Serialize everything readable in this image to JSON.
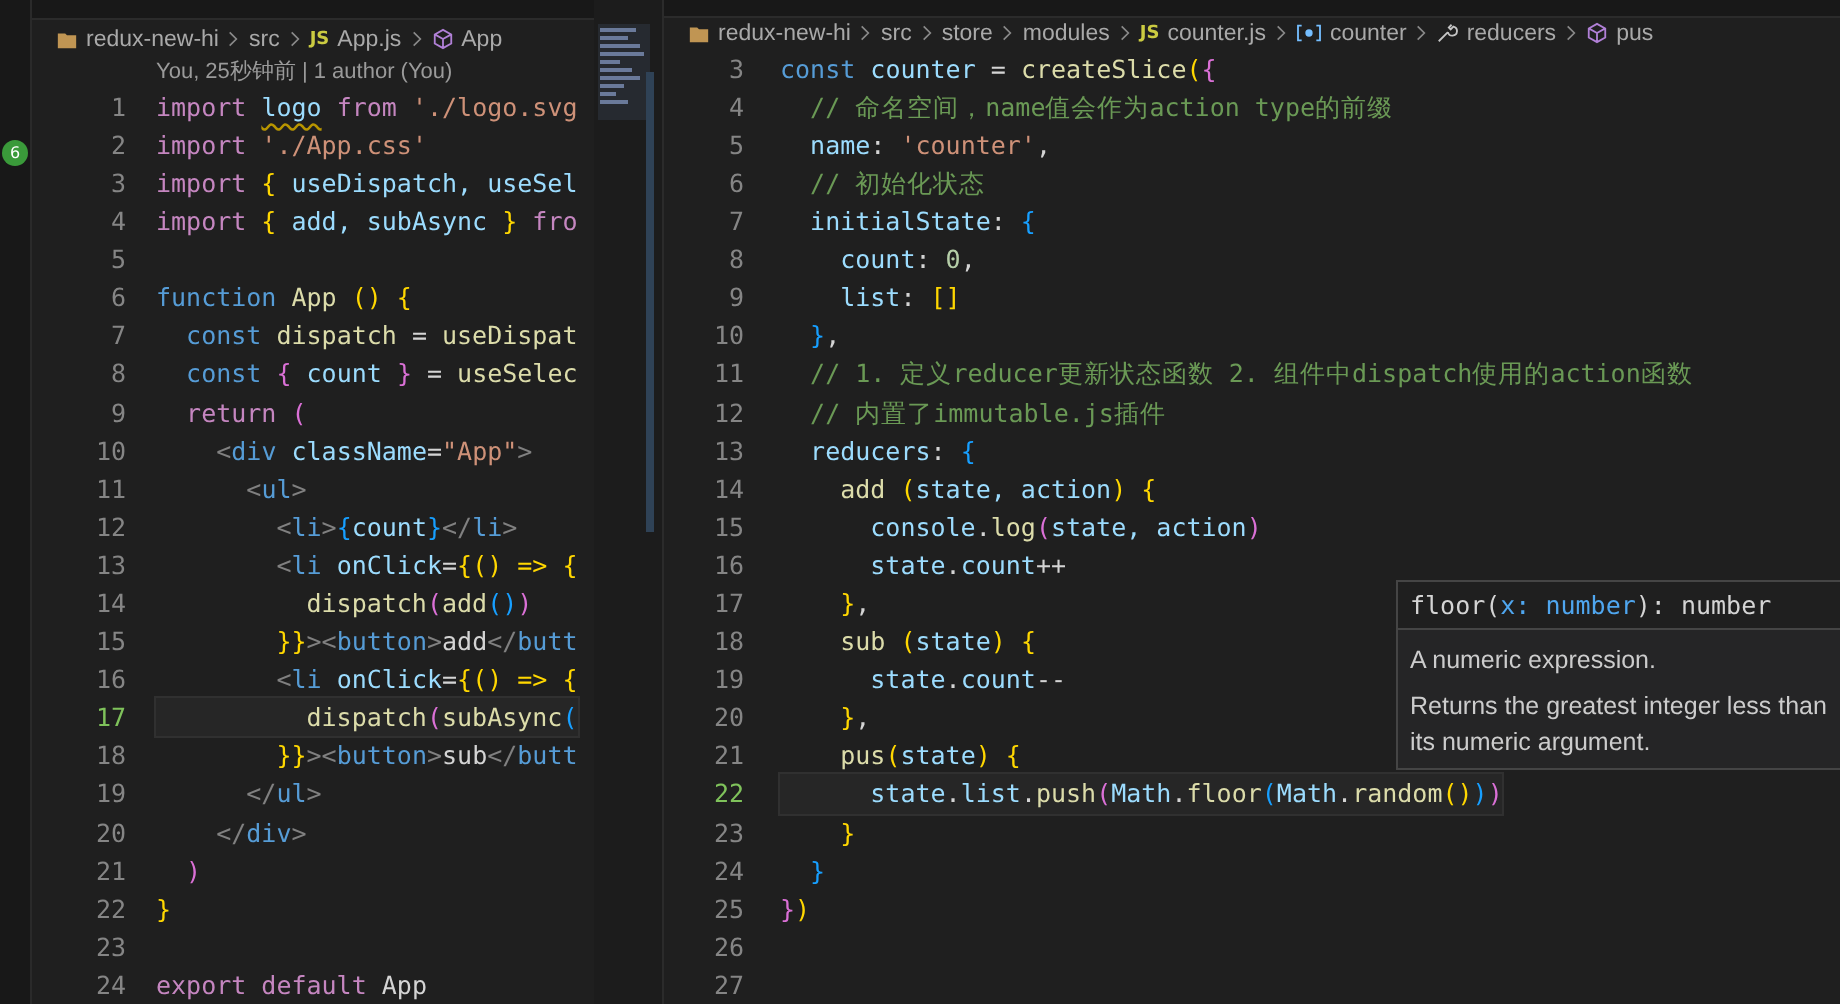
{
  "activity_bar": {
    "badge": "6"
  },
  "left_editor": {
    "breadcrumb": [
      {
        "label": "redux-new-hi",
        "kind": "folder"
      },
      {
        "label": "src",
        "kind": "plain"
      },
      {
        "label": "App.js",
        "kind": "file",
        "badge": "JS"
      },
      {
        "label": "App",
        "kind": "class"
      }
    ],
    "blame": "You, 25秒钟前 | 1 author (You)",
    "lines": [
      {
        "n": "1",
        "current": false,
        "tokens": [
          {
            "text": "import ",
            "kind": "kw"
          },
          {
            "text": "logo",
            "kind": "warn"
          },
          {
            "text": " from",
            "kind": "kw"
          },
          {
            "text": " './logo.svg",
            "kind": "str"
          }
        ]
      },
      {
        "n": "2",
        "current": false,
        "tokens": [
          {
            "text": "import",
            "kind": "kw"
          },
          {
            "text": " './App.css'",
            "kind": "str"
          }
        ]
      },
      {
        "n": "3",
        "current": false,
        "tokens": [
          {
            "text": "import",
            "kind": "kw"
          },
          {
            "text": " {",
            "kind": "b1"
          },
          {
            "text": " useDispatch, useSel",
            "kind": "var"
          }
        ]
      },
      {
        "n": "4",
        "current": false,
        "tokens": [
          {
            "text": "import",
            "kind": "kw"
          },
          {
            "text": " {",
            "kind": "b1"
          },
          {
            "text": " add, subAsync ",
            "kind": "var"
          },
          {
            "text": "}",
            "kind": "b1"
          },
          {
            "text": " fro",
            "kind": "kw"
          }
        ]
      },
      {
        "n": "5",
        "current": false
      },
      {
        "n": "6",
        "current": false,
        "tokens": [
          {
            "text": "function",
            "kind": "st"
          },
          {
            "text": " App ",
            "kind": "fn"
          },
          {
            "text": "() {",
            "kind": "b1"
          }
        ]
      },
      {
        "n": "7",
        "current": false,
        "tokens": [
          {
            "text": "  const",
            "kind": "st"
          },
          {
            "text": " dispatch",
            "kind": "fn"
          },
          {
            "text": " = ",
            "kind": "p"
          },
          {
            "text": "useDispat",
            "kind": "fn"
          }
        ]
      },
      {
        "n": "8",
        "current": false,
        "tokens": [
          {
            "text": "  const",
            "kind": "st"
          },
          {
            "text": " {",
            "kind": "b2"
          },
          {
            "text": " count ",
            "kind": "var"
          },
          {
            "text": "}",
            "kind": "b2"
          },
          {
            "text": " = ",
            "kind": "p"
          },
          {
            "text": "useSelec",
            "kind": "fn"
          }
        ]
      },
      {
        "n": "9",
        "current": false,
        "tokens": [
          {
            "text": "  return",
            "kind": "kw"
          },
          {
            "text": " (",
            "kind": "b2"
          }
        ]
      },
      {
        "n": "10",
        "current": false,
        "tokens": [
          {
            "text": "    <",
            "kind": "tg"
          },
          {
            "text": "div",
            "kind": "st"
          },
          {
            "text": " className",
            "kind": "var"
          },
          {
            "text": "=",
            "kind": "p"
          },
          {
            "text": "\"App\"",
            "kind": "str"
          },
          {
            "text": ">",
            "kind": "tg"
          }
        ]
      },
      {
        "n": "11",
        "current": false,
        "tokens": [
          {
            "text": "      <",
            "kind": "tg"
          },
          {
            "text": "ul",
            "kind": "st"
          },
          {
            "text": ">",
            "kind": "tg"
          }
        ]
      },
      {
        "n": "12",
        "current": false,
        "tokens": [
          {
            "text": "        <",
            "kind": "tg"
          },
          {
            "text": "li",
            "kind": "st"
          },
          {
            "text": ">",
            "kind": "tg"
          },
          {
            "text": "{",
            "kind": "b3"
          },
          {
            "text": "count",
            "kind": "var"
          },
          {
            "text": "}",
            "kind": "b3"
          },
          {
            "text": "</",
            "kind": "tg"
          },
          {
            "text": "li",
            "kind": "st"
          },
          {
            "text": ">",
            "kind": "tg"
          }
        ]
      },
      {
        "n": "13",
        "current": false,
        "tokens": [
          {
            "text": "        <",
            "kind": "tg"
          },
          {
            "text": "li",
            "kind": "st"
          },
          {
            "text": " onClick",
            "kind": "var"
          },
          {
            "text": "=",
            "kind": "p"
          },
          {
            "text": "{() => {",
            "kind": "b1"
          }
        ]
      },
      {
        "n": "14",
        "current": false,
        "tokens": [
          {
            "text": "          dispatch",
            "kind": "fn"
          },
          {
            "text": "(",
            "kind": "b2"
          },
          {
            "text": "add",
            "kind": "fn"
          },
          {
            "text": "()",
            "kind": "b3"
          },
          {
            "text": ")",
            "kind": "b2"
          }
        ]
      },
      {
        "n": "15",
        "current": false,
        "tokens": [
          {
            "text": "        }}",
            "kind": "b1"
          },
          {
            "text": "><",
            "kind": "tg"
          },
          {
            "text": "button",
            "kind": "st"
          },
          {
            "text": ">",
            "kind": "tg"
          },
          {
            "text": "add",
            "kind": "p"
          },
          {
            "text": "</",
            "kind": "tg"
          },
          {
            "text": "butt",
            "kind": "st"
          }
        ]
      },
      {
        "n": "16",
        "current": false,
        "tokens": [
          {
            "text": "        <",
            "kind": "tg"
          },
          {
            "text": "li",
            "kind": "st"
          },
          {
            "text": " onClick",
            "kind": "var"
          },
          {
            "text": "=",
            "kind": "p"
          },
          {
            "text": "{() => {",
            "kind": "b1"
          }
        ]
      },
      {
        "n": "17",
        "current": true,
        "tokens": [
          {
            "text": "          dispatch",
            "kind": "fn"
          },
          {
            "text": "(",
            "kind": "b2"
          },
          {
            "text": "subAsync",
            "kind": "fn"
          },
          {
            "text": "(",
            "kind": "b3"
          }
        ]
      },
      {
        "n": "18",
        "current": false,
        "tokens": [
          {
            "text": "        }}",
            "kind": "b1"
          },
          {
            "text": "><",
            "kind": "tg"
          },
          {
            "text": "button",
            "kind": "st"
          },
          {
            "text": ">",
            "kind": "tg"
          },
          {
            "text": "sub",
            "kind": "p"
          },
          {
            "text": "</",
            "kind": "tg"
          },
          {
            "text": "butt",
            "kind": "st"
          }
        ]
      },
      {
        "n": "19",
        "current": false,
        "tokens": [
          {
            "text": "      </",
            "kind": "tg"
          },
          {
            "text": "ul",
            "kind": "st"
          },
          {
            "text": ">",
            "kind": "tg"
          }
        ]
      },
      {
        "n": "20",
        "current": false,
        "tokens": [
          {
            "text": "    </",
            "kind": "tg"
          },
          {
            "text": "div",
            "kind": "st"
          },
          {
            "text": ">",
            "kind": "tg"
          }
        ]
      },
      {
        "n": "21",
        "current": false,
        "tokens": [
          {
            "text": "  )",
            "kind": "b2"
          }
        ]
      },
      {
        "n": "22",
        "current": false,
        "tokens": [
          {
            "text": "}",
            "kind": "b1"
          }
        ]
      },
      {
        "n": "23",
        "current": false
      },
      {
        "n": "24",
        "current": false,
        "tokens": [
          {
            "text": "export",
            "kind": "kw"
          },
          {
            "text": " default",
            "kind": "kw"
          },
          {
            "text": " App",
            "kind": "p"
          }
        ]
      }
    ]
  },
  "right_editor": {
    "breadcrumb": [
      {
        "label": "redux-new-hi",
        "kind": "folder"
      },
      {
        "label": "src",
        "kind": "plain"
      },
      {
        "label": "store",
        "kind": "plain"
      },
      {
        "label": "modules",
        "kind": "plain"
      },
      {
        "label": "counter.js",
        "kind": "file",
        "badge": "JS"
      },
      {
        "label": "counter",
        "kind": "variable"
      },
      {
        "label": "reducers",
        "kind": "property"
      },
      {
        "label": "pus",
        "kind": "class"
      }
    ],
    "lines": [
      {
        "n": "3",
        "current": false,
        "tokens": [
          {
            "text": "const",
            "kind": "st"
          },
          {
            "text": " counter",
            "kind": "var"
          },
          {
            "text": " = ",
            "kind": "p"
          },
          {
            "text": "createSlice",
            "kind": "fn"
          },
          {
            "text": "(",
            "kind": "b1"
          },
          {
            "text": "{",
            "kind": "b2"
          }
        ]
      },
      {
        "n": "4",
        "current": false,
        "tokens": [
          {
            "text": "  // 命名空间，name值会作为action type的前缀",
            "kind": "cm"
          }
        ]
      },
      {
        "n": "5",
        "current": false,
        "tokens": [
          {
            "text": "  name",
            "kind": "var"
          },
          {
            "text": ": ",
            "kind": "p"
          },
          {
            "text": "'counter'",
            "kind": "str"
          },
          {
            "text": ",",
            "kind": "p"
          }
        ]
      },
      {
        "n": "6",
        "current": false,
        "tokens": [
          {
            "text": "  // 初始化状态",
            "kind": "cm"
          }
        ]
      },
      {
        "n": "7",
        "current": false,
        "tokens": [
          {
            "text": "  initialState",
            "kind": "var"
          },
          {
            "text": ": ",
            "kind": "p"
          },
          {
            "text": "{",
            "kind": "b3"
          }
        ]
      },
      {
        "n": "8",
        "current": false,
        "tokens": [
          {
            "text": "    count",
            "kind": "var"
          },
          {
            "text": ": ",
            "kind": "p"
          },
          {
            "text": "0",
            "kind": "num"
          },
          {
            "text": ",",
            "kind": "p"
          }
        ]
      },
      {
        "n": "9",
        "current": false,
        "tokens": [
          {
            "text": "    list",
            "kind": "var"
          },
          {
            "text": ": ",
            "kind": "p"
          },
          {
            "text": "[]",
            "kind": "b1"
          }
        ]
      },
      {
        "n": "10",
        "current": false,
        "tokens": [
          {
            "text": "  }",
            "kind": "b3"
          },
          {
            "text": ",",
            "kind": "p"
          }
        ]
      },
      {
        "n": "11",
        "current": false,
        "tokens": [
          {
            "text": "  // 1. 定义reducer更新状态函数 2. 组件中dispatch使用的action函数",
            "kind": "cm"
          }
        ]
      },
      {
        "n": "12",
        "current": false,
        "tokens": [
          {
            "text": "  // 内置了immutable.js插件",
            "kind": "cm"
          }
        ]
      },
      {
        "n": "13",
        "current": false,
        "tokens": [
          {
            "text": "  reducers",
            "kind": "var"
          },
          {
            "text": ": ",
            "kind": "p"
          },
          {
            "text": "{",
            "kind": "b3"
          }
        ]
      },
      {
        "n": "14",
        "current": false,
        "tokens": [
          {
            "text": "    add ",
            "kind": "fn"
          },
          {
            "text": "(",
            "kind": "b1"
          },
          {
            "text": "state, action",
            "kind": "var"
          },
          {
            "text": ")",
            "kind": "b1"
          },
          {
            "text": " {",
            "kind": "b1"
          }
        ]
      },
      {
        "n": "15",
        "current": false,
        "tokens": [
          {
            "text": "      console",
            "kind": "var"
          },
          {
            "text": ".",
            "kind": "p"
          },
          {
            "text": "log",
            "kind": "fn"
          },
          {
            "text": "(",
            "kind": "b2"
          },
          {
            "text": "state, action",
            "kind": "var"
          },
          {
            "text": ")",
            "kind": "b2"
          }
        ]
      },
      {
        "n": "16",
        "current": false,
        "tokens": [
          {
            "text": "      state",
            "kind": "var"
          },
          {
            "text": ".",
            "kind": "p"
          },
          {
            "text": "count",
            "kind": "var"
          },
          {
            "text": "++",
            "kind": "p"
          }
        ]
      },
      {
        "n": "17",
        "current": false,
        "tokens": [
          {
            "text": "    }",
            "kind": "b1"
          },
          {
            "text": ",",
            "kind": "p"
          }
        ]
      },
      {
        "n": "18",
        "current": false,
        "tokens": [
          {
            "text": "    sub ",
            "kind": "fn"
          },
          {
            "text": "(",
            "kind": "b1"
          },
          {
            "text": "state",
            "kind": "var"
          },
          {
            "text": ")",
            "kind": "b1"
          },
          {
            "text": " {",
            "kind": "b1"
          }
        ]
      },
      {
        "n": "19",
        "current": false,
        "tokens": [
          {
            "text": "      state",
            "kind": "var"
          },
          {
            "text": ".",
            "kind": "p"
          },
          {
            "text": "count",
            "kind": "var"
          },
          {
            "text": "--",
            "kind": "p"
          }
        ]
      },
      {
        "n": "20",
        "current": false,
        "tokens": [
          {
            "text": "    }",
            "kind": "b1"
          },
          {
            "text": ",",
            "kind": "p"
          }
        ]
      },
      {
        "n": "21",
        "current": false,
        "tokens": [
          {
            "text": "    pus",
            "kind": "fn"
          },
          {
            "text": "(",
            "kind": "b1"
          },
          {
            "text": "state",
            "kind": "var"
          },
          {
            "text": ")",
            "kind": "b1"
          },
          {
            "text": " {",
            "kind": "b1"
          }
        ]
      },
      {
        "n": "22",
        "current": true,
        "tokens": [
          {
            "text": "      state",
            "kind": "var"
          },
          {
            "text": ".",
            "kind": "p"
          },
          {
            "text": "list",
            "kind": "var"
          },
          {
            "text": ".",
            "kind": "p"
          },
          {
            "text": "push",
            "kind": "fn"
          },
          {
            "text": "(",
            "kind": "b2"
          },
          {
            "text": "Math",
            "kind": "var"
          },
          {
            "text": ".",
            "kind": "p"
          },
          {
            "text": "floor",
            "kind": "fn"
          },
          {
            "text": "(",
            "kind": "b3"
          },
          {
            "text": "Math",
            "kind": "var"
          },
          {
            "text": ".",
            "kind": "p"
          },
          {
            "text": "random",
            "kind": "fn"
          },
          {
            "text": "()",
            "kind": "b1"
          },
          {
            "text": ")",
            "kind": "b3"
          },
          {
            "text": ")",
            "kind": "b2"
          }
        ]
      },
      {
        "n": "23",
        "current": false,
        "tokens": [
          {
            "text": "    }",
            "kind": "b1"
          }
        ]
      },
      {
        "n": "24",
        "current": false,
        "tokens": [
          {
            "text": "  }",
            "kind": "b3"
          }
        ]
      },
      {
        "n": "25",
        "current": false,
        "tokens": [
          {
            "text": "}",
            "kind": "b2"
          },
          {
            "text": ")",
            "kind": "b1"
          }
        ]
      },
      {
        "n": "26",
        "current": false
      },
      {
        "n": "27",
        "current": false
      }
    ]
  },
  "hover": {
    "signature": [
      {
        "text": "floor(",
        "kind": "p"
      },
      {
        "text": "x: ",
        "kind": "sig"
      },
      {
        "text": "number",
        "kind": "sig"
      },
      {
        "text": "): number",
        "kind": "p"
      }
    ],
    "description": "A numeric expression.",
    "details": "Returns the greatest integer less than its numeric argument."
  }
}
